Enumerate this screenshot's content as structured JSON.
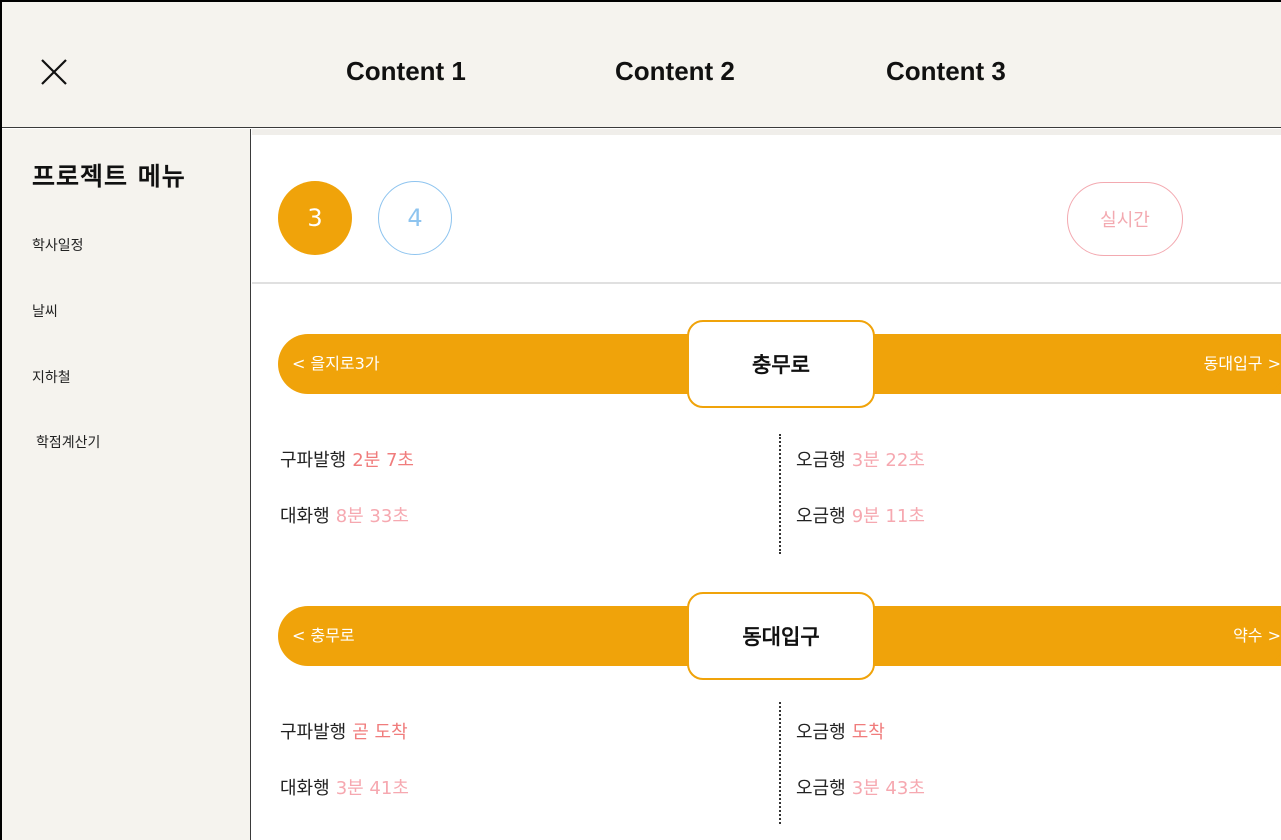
{
  "header": {
    "close_icon": "close-icon",
    "nav": [
      "Content 1",
      "Content 2",
      "Content 3"
    ]
  },
  "sidebar": {
    "title": "프로젝트 메뉴",
    "items": [
      "학사일정",
      "날씨",
      "지하철",
      "학점계산기"
    ]
  },
  "line_selector": {
    "lines": [
      "3",
      "4"
    ],
    "selected": "3",
    "realtime_label": "실시간"
  },
  "colors": {
    "line3": "#f0a30a",
    "line4": "#8ec4ef",
    "realtime": "#f3a9b0",
    "arrival_red": "#f07c7c",
    "arrival_pink": "#f6a8b0"
  },
  "stations": [
    {
      "name": "충무로",
      "prev": "< 을지로3가",
      "next": "동대입구 >",
      "left": [
        {
          "dest": "구파발행",
          "time": "2분 7초"
        },
        {
          "dest": "대화행",
          "time": "8분 33초"
        }
      ],
      "right": [
        {
          "dest": "오금행",
          "time": "3분 22초"
        },
        {
          "dest": "오금행",
          "time": "9분 11초"
        }
      ]
    },
    {
      "name": "동대입구",
      "prev": "< 충무로",
      "next": "약수 >",
      "left": [
        {
          "dest": "구파발행",
          "time": "곧 도착"
        },
        {
          "dest": "대화행",
          "time": "3분 41초"
        }
      ],
      "right": [
        {
          "dest": "오금행",
          "time": "도착"
        },
        {
          "dest": "오금행",
          "time": "3분 43초"
        }
      ]
    }
  ]
}
